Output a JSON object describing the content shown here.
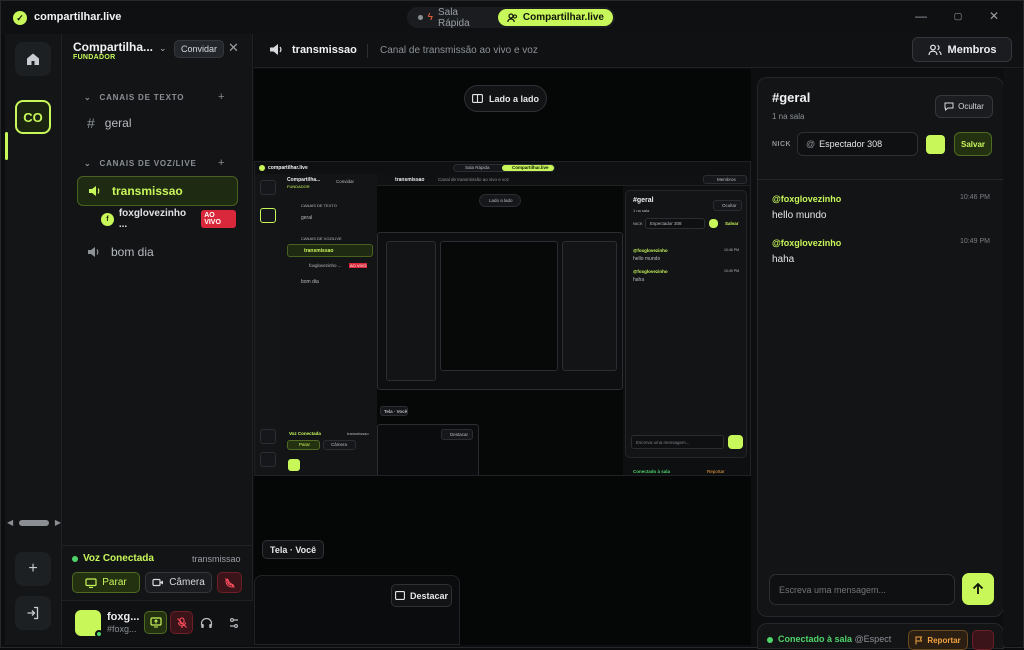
{
  "app": {
    "title": "compartilhar.live"
  },
  "tabs": [
    {
      "label": "Sala Rápida"
    },
    {
      "label": "Compartilhar.live"
    }
  ],
  "window_controls": {
    "minimize": "—",
    "maximize": "▢",
    "close": "✕"
  },
  "rail": {
    "server_initials": "CO"
  },
  "server": {
    "name": "Compartilha...",
    "role": "FUNDADOR",
    "invite_label": "Convidar"
  },
  "sections": {
    "text": "CANAIS DE TEXTO",
    "voice": "CANAIS DE VOZ/LIVE"
  },
  "channels": {
    "text": [
      {
        "name": "geral"
      }
    ],
    "voice": [
      {
        "name": "transmissao"
      },
      {
        "name": "bom dia"
      }
    ]
  },
  "voice_user": {
    "name": "foxglovezinho ...",
    "badge": "AO VIVO",
    "initial": "f"
  },
  "voice_panel": {
    "status": "Voz Conectada",
    "channel": "transmissao",
    "stop_label": "Parar",
    "camera_label": "Câmera"
  },
  "user": {
    "name": "foxg...",
    "tag": "#foxg..."
  },
  "header": {
    "channel": "transmissao",
    "description": "Canal de transmissão ao vivo e voz",
    "members_label": "Membros"
  },
  "stream": {
    "side_by_side_label": "Lado a lado",
    "screen_label": "Tela · Você",
    "highlight_label": "Destacar"
  },
  "chat": {
    "title": "#geral",
    "subtitle": "1 na sala",
    "hide_label": "Ocultar",
    "nick_label": "NICK",
    "nick_value": "Espectador 308",
    "save_label": "Salvar",
    "accent_color": "#c8f75a",
    "messages": [
      {
        "author": "@foxglovezinho",
        "time": "10:46 PM",
        "text": "hello mundo"
      },
      {
        "author": "@foxglovezinho",
        "time": "10:49 PM",
        "text": "haha"
      }
    ],
    "input_placeholder": "Escreva uma mensagem..."
  },
  "connection": {
    "status": "Conectado à sala",
    "nick": "@Espect",
    "report_label": "Reportar"
  },
  "mini": {
    "app_title": "compartilhar.live",
    "server_name": "Compartilha...",
    "role": "FUNDADOR",
    "invite": "Convidar",
    "sec_text": "CANAIS DE TEXTO",
    "chan_geral": "geral",
    "sec_voice": "CANAIS DE VOZ/LIVE",
    "chan_trans": "transmissao",
    "chan_bomdia": "bom dia",
    "voice_user": "foxglovezinho ...",
    "live": "AO VIVO",
    "vc": "Voz Conectada",
    "vc_chan": "transmissao",
    "header": "transmissao",
    "header_desc": "Canal de transmissão ao vivo e voz",
    "members": "Membros",
    "sbs": "Lado a lado",
    "tela": "Tela · Você",
    "destacar": "Destacar",
    "chat_title": "#geral",
    "chat_sub": "1 na sala",
    "hide": "Ocultar",
    "nick": "NICK",
    "nick_val": "Espectador 308",
    "save": "Salvar",
    "author": "@foxglovezinho",
    "t1": "10:46 PM",
    "m1": "hello mundo",
    "t2": "10:49 PM",
    "m2": "haha",
    "input": "Escreva uma mensagem...",
    "conn": "Conectado à sala",
    "report": "Reportar",
    "stop": "Parar",
    "camera": "Câmera",
    "tab1": "Sala Rápida",
    "tab2": "Compartilhar.live"
  }
}
